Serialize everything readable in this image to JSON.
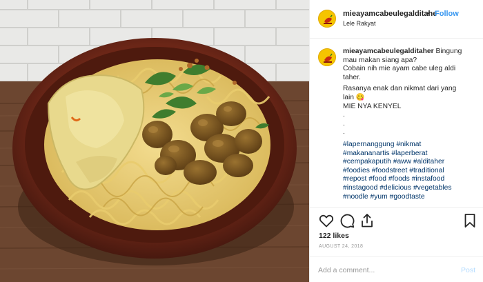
{
  "post": {
    "username": "mieayamcabeulegalditahe",
    "follow_separator": "•",
    "follow_label": "Follow",
    "location": "Lele Rakyat",
    "avatar_icon": "chili-logo-icon",
    "accent_color": "#3897f0"
  },
  "photo": {
    "subject": "food-photo"
  },
  "caption": {
    "username": "mieayamcabeulegalditaher",
    "line1_rest": " Bingung",
    "lines": [
      "mau makan siang apa?",
      "Cobain nih mie ayam cabe uleg aldi",
      "taher."
    ],
    "lines2": [
      "Rasanya enak dan nikmat dari yang",
      "lain 😋",
      "MIE NYA KENYEL",
      ".",
      ".",
      "."
    ],
    "hashtag_lines": [
      [
        "#lapernanggung",
        "#nikmat"
      ],
      [
        "#makananartis",
        "#laperberat"
      ],
      [
        "#cempakaputih",
        "#aww",
        "#alditaher"
      ],
      [
        "#foodies",
        "#foodstreet",
        "#traditional"
      ],
      [
        "#repost",
        "#food",
        "#foods",
        "#instafood"
      ],
      [
        "#instagood",
        "#delicious",
        "#vegetables"
      ],
      [
        "#noodle",
        "#yum",
        "#goodtaste"
      ]
    ]
  },
  "actions": {
    "like_icon": "heart-icon",
    "comment_icon": "comment-icon",
    "share_icon": "share-icon",
    "save_icon": "bookmark-icon",
    "likes": "122 likes",
    "date": "AUGUST 24, 2018"
  },
  "comment_form": {
    "placeholder": "Add a comment...",
    "value": "",
    "post_label": "Post"
  }
}
